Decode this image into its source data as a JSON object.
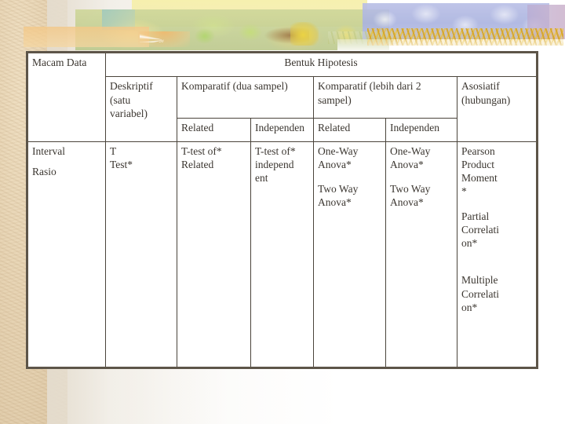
{
  "slide": {
    "background_color": "#ffffff",
    "paper_color": "#e3cfae",
    "border_color": "#5d5549",
    "text_color": "#3b3630"
  },
  "banner": {
    "name": "decorative-floral-banner",
    "motifs": [
      "yellow-wash",
      "olive-foliage",
      "white-starburst-flower",
      "green-leaves",
      "yellow-pears",
      "brown-bird",
      "blue-hydrangea",
      "golden-wheat",
      "violet-wash"
    ],
    "colors": {
      "yellow": "#f4edb0",
      "olive": "#c4cf92",
      "tan": "#f3c888",
      "teal": "#96c6c4",
      "blue": "#aab3e0",
      "violet": "#bfa9d0",
      "wheat_gold": "#d6a21e"
    }
  },
  "table": {
    "name": "statistical-test-selection-matrix",
    "header": {
      "macam_data": "Macam Data",
      "bentuk_hipotesis": "Bentuk Hipotesis",
      "groups": [
        {
          "label": "Deskriptif (satu variabel)",
          "lines": [
            "Deskriptif",
            "(satu",
            "variabel)"
          ],
          "subs": []
        },
        {
          "label": "Komparatif (dua sampel)",
          "lines": [
            "Komparatif (dua sampel)"
          ],
          "subs": [
            "Related",
            "Independen"
          ]
        },
        {
          "label": "Komparatif (lebih dari 2 sampel)",
          "lines": [
            "Komparatif (lebih dari 2",
            "sampel)"
          ],
          "subs": [
            "Related",
            "Independen"
          ]
        },
        {
          "label": "Asosiatif (hubungan)",
          "lines": [
            "Asosiatif",
            "(hubungan)"
          ],
          "subs": []
        }
      ]
    },
    "rows": [
      {
        "data_type_lines": [
          "Interval",
          "Rasio"
        ],
        "deskriptif": [
          "T",
          "Test*"
        ],
        "komparatif_dua_related": [
          "T-test of*",
          "Related"
        ],
        "komparatif_dua_independen": [
          "T-test of*",
          "independ",
          "ent"
        ],
        "komparatif_banyak_related": [
          "One-Way",
          "Anova*",
          "",
          "Two Way",
          "Anova*"
        ],
        "komparatif_banyak_independen": [
          "One-Way",
          "Anova*",
          "",
          "Two Way",
          "Anova*"
        ],
        "asosiatif": [
          "Pearson",
          "Product",
          "Moment",
          "*",
          "",
          "Partial",
          "Correlati",
          "on*",
          "",
          "",
          "Multiple",
          "Correlati",
          "on*"
        ]
      }
    ]
  }
}
